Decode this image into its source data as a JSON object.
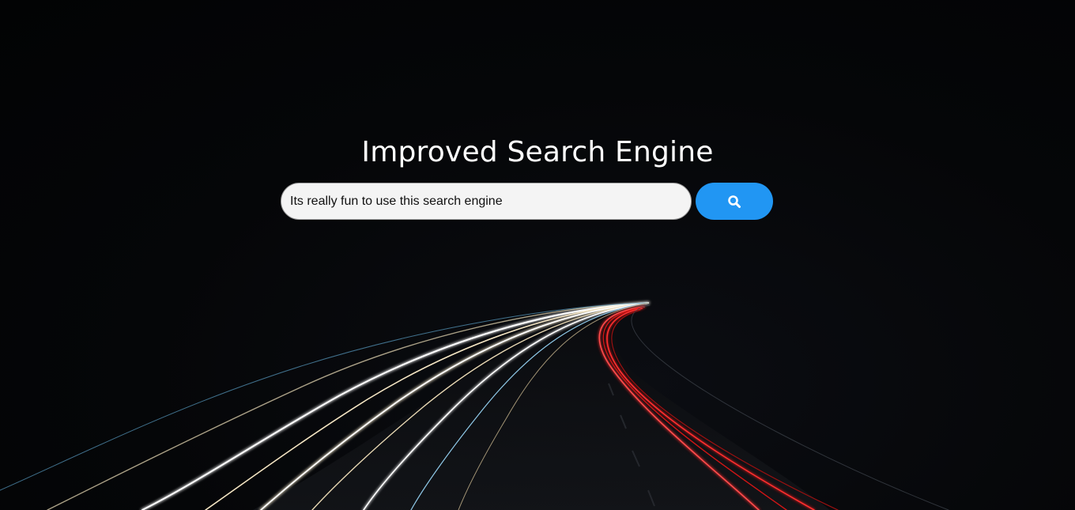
{
  "page": {
    "title": "Improved Search Engine"
  },
  "search": {
    "value": "Its really fun to use this search engine",
    "placeholder": "",
    "button_icon": "search-icon"
  },
  "colors": {
    "background": "#050608",
    "accent": "#2196f3",
    "input_background": "#f4f4f4",
    "title_text": "#ffffff"
  },
  "background_image": "night highway light trails"
}
